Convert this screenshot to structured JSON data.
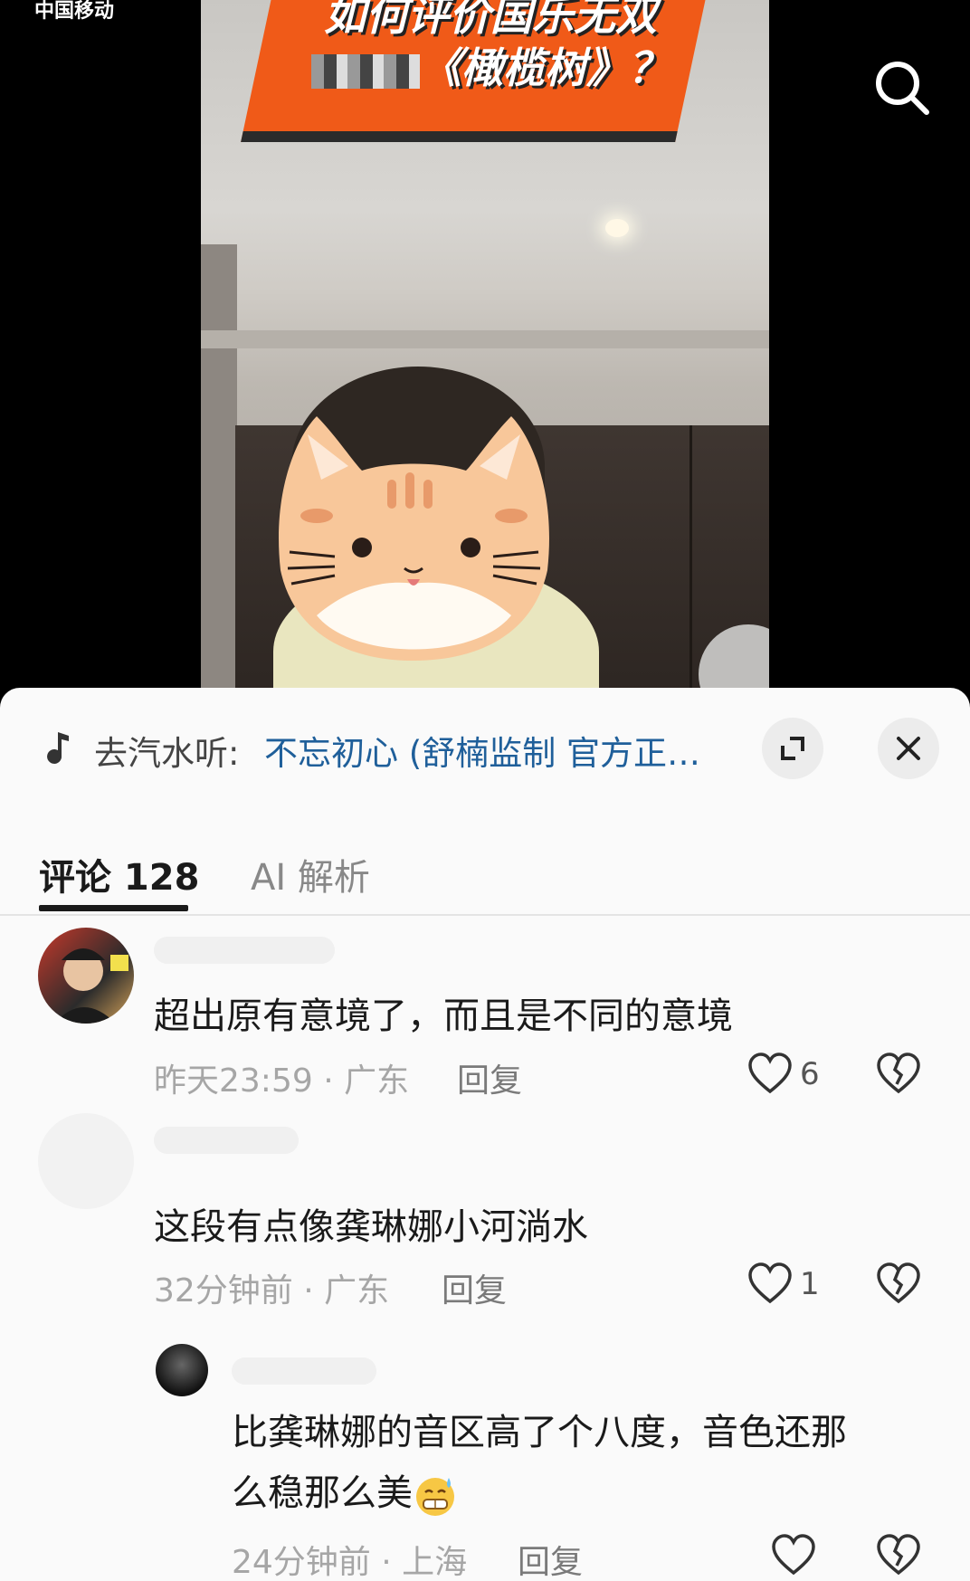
{
  "status_bar": {
    "carrier": "中国移动"
  },
  "video": {
    "banner_line1": "如何评价国乐无双",
    "banner_line2": "《橄榄树》？"
  },
  "music": {
    "prefix": "去汽水听:",
    "title": "不忘初心 (舒楠监制 官方正…"
  },
  "tabs": [
    {
      "label": "评论 128",
      "active": true
    },
    {
      "label": "AI 解析",
      "active": false
    }
  ],
  "comments": [
    {
      "text": "超出原有意境了，而且是不同的意境",
      "meta": "昨天23:59 · 广东",
      "reply": "回复",
      "likes": "6"
    },
    {
      "text": "这段有点像龚琳娜小河淌水",
      "meta": "32分钟前 · 广东",
      "reply": "回复",
      "likes": "1"
    },
    {
      "text_line1": "比龚琳娜的音区高了个八度，音色还那",
      "text_line2": "么稳那么美",
      "meta": "24分钟前 · 上海",
      "reply": "回复",
      "likes": ""
    }
  ],
  "colors": {
    "accent_link": "#1f5f9a",
    "banner_orange": "#f05a18",
    "sheet_bg": "#fafafa"
  }
}
